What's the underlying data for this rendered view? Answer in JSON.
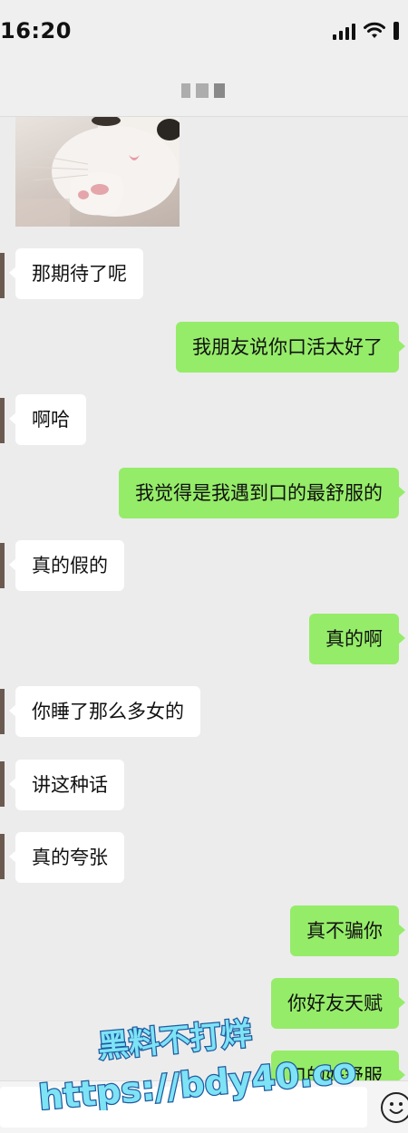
{
  "status_bar": {
    "time": "16:20"
  },
  "nav": {
    "title": ""
  },
  "messages": [
    {
      "side": "left",
      "text": "那期待了呢"
    },
    {
      "side": "right",
      "text": "我朋友说你口活太好了"
    },
    {
      "side": "left",
      "text": "啊哈"
    },
    {
      "side": "right",
      "text": "我觉得是我遇到口的最舒服的"
    },
    {
      "side": "left",
      "text": "真的假的"
    },
    {
      "side": "right",
      "text": "真的啊"
    },
    {
      "side": "left",
      "text": "你睡了那么多女的"
    },
    {
      "side": "left",
      "text": "讲这种话"
    },
    {
      "side": "left",
      "text": "真的夸张"
    },
    {
      "side": "right",
      "text": "真不骗你"
    },
    {
      "side": "right",
      "text": "你好友天赋"
    },
    {
      "side": "right",
      "text": "口的好舒服"
    }
  ],
  "watermark": {
    "line1": "黑料不打烊",
    "line2": "https://bdy40.co"
  },
  "colors": {
    "right_bubble": "#95ec69",
    "left_bubble": "#ffffff",
    "background": "#ececec"
  },
  "icons": {
    "emoji": "emoji-icon",
    "sticker": "cat-sticker"
  }
}
